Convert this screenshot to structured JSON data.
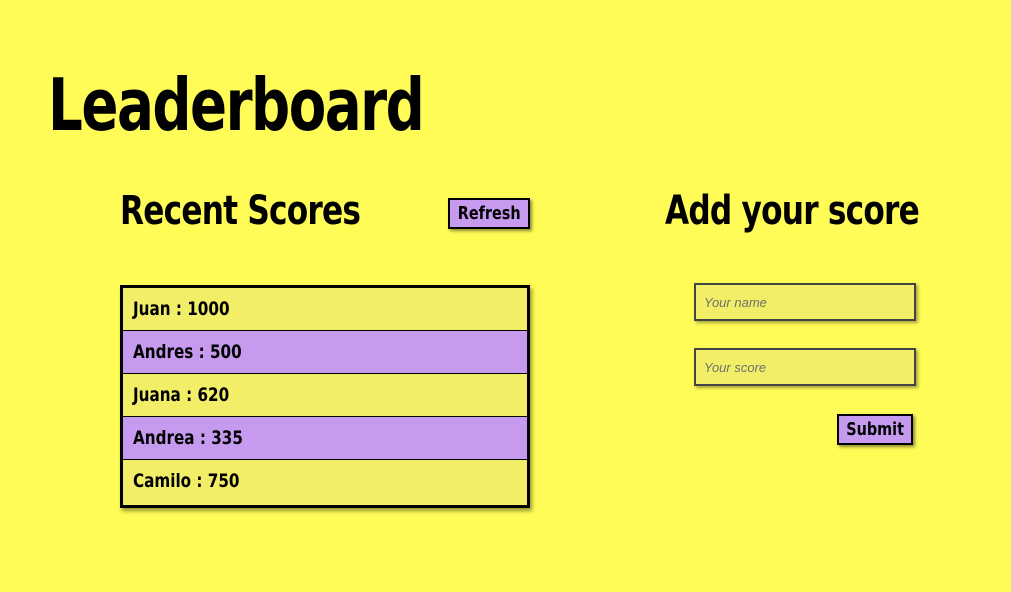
{
  "page": {
    "title": "Leaderboard"
  },
  "recent": {
    "heading": "Recent Scores",
    "refresh_label": "Refresh",
    "scores": [
      {
        "text": "Juan : 1000"
      },
      {
        "text": "Andres : 500"
      },
      {
        "text": "Juana : 620"
      },
      {
        "text": "Andrea : 335"
      },
      {
        "text": "Camilo : 750"
      }
    ]
  },
  "form": {
    "heading": "Add your score",
    "name_placeholder": "Your name",
    "score_placeholder": "Your score",
    "submit_label": "Submit"
  },
  "colors": {
    "background": "#fffb57",
    "row_light": "#f3ee68",
    "accent_purple": "#c69aef"
  }
}
